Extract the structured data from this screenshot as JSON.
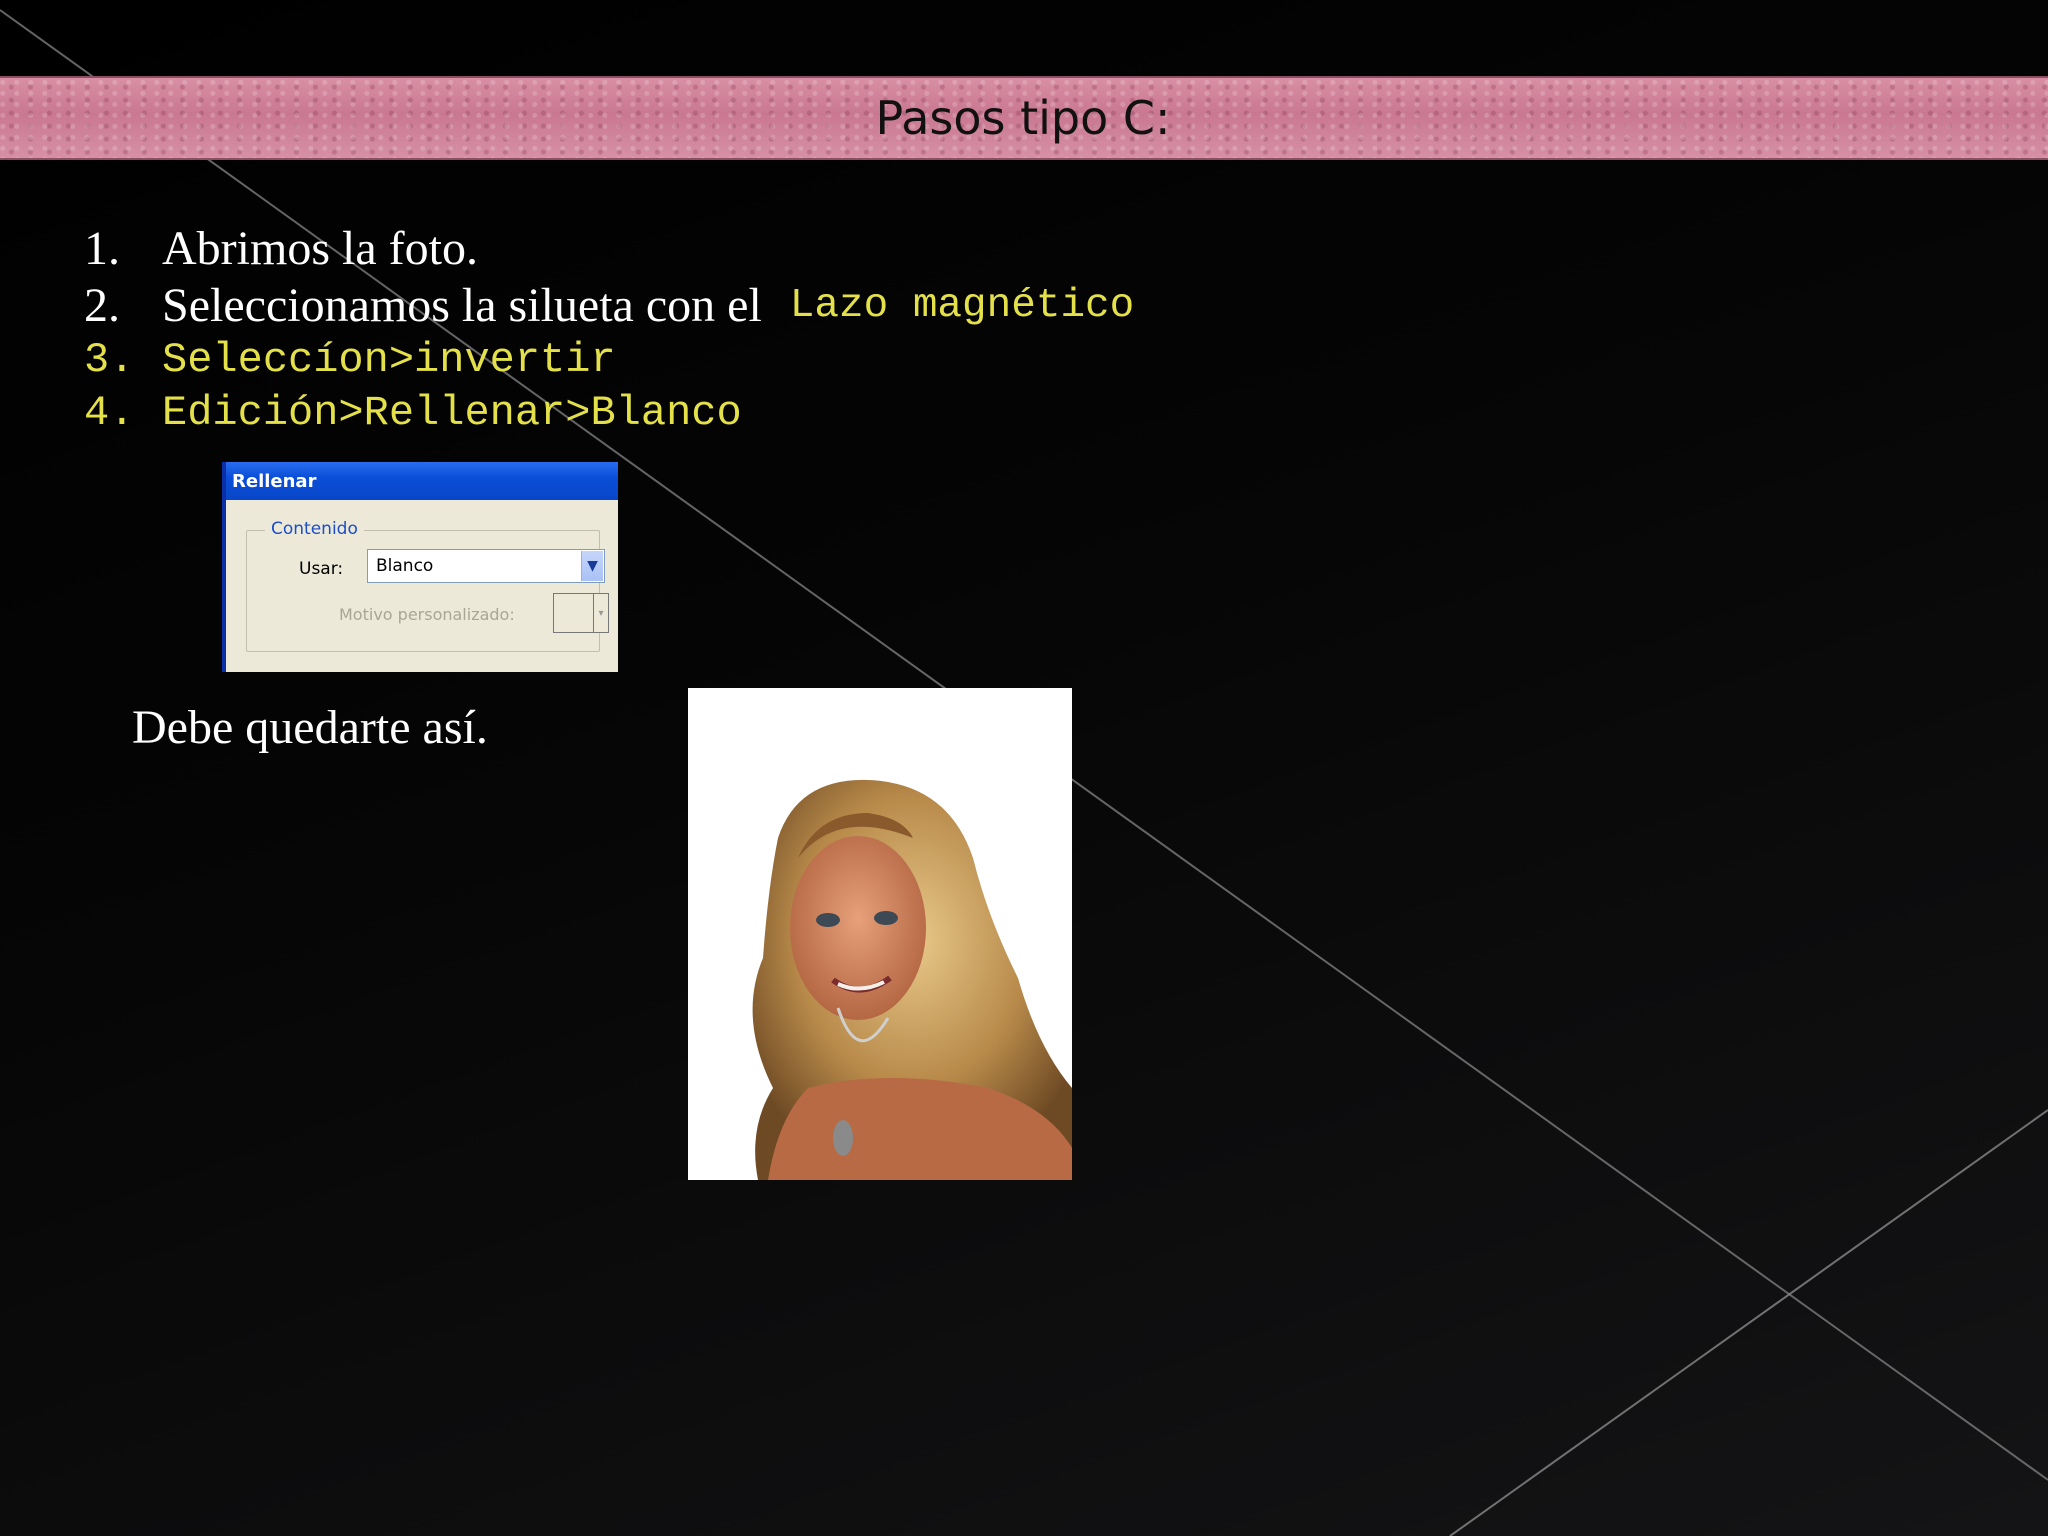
{
  "slide": {
    "title": "Pasos tipo C:",
    "steps": [
      {
        "num": "1.",
        "text": "Abrimos la foto."
      },
      {
        "num": "2.",
        "text": "Seleccionamos la silueta con el",
        "tool": "Lazo magnético"
      },
      {
        "num": "3.",
        "text": "Seleccíon>invertir"
      },
      {
        "num": "4.",
        "text": "Edición>Rellenar>Blanco"
      }
    ],
    "result_text": "Debe quedarte así."
  },
  "dialog": {
    "title": "Rellenar",
    "group_label": "Contenido",
    "use_label": "Usar:",
    "use_value": "Blanco",
    "pattern_label": "Motivo personalizado:"
  },
  "colors": {
    "title_bar": "#d08aa0",
    "highlight_text": "#e3e04a",
    "body_text": "#ffffff",
    "dialog_title_bar": "#0a4fd8"
  },
  "icons": {
    "dropdown": "chevron-down-icon"
  }
}
